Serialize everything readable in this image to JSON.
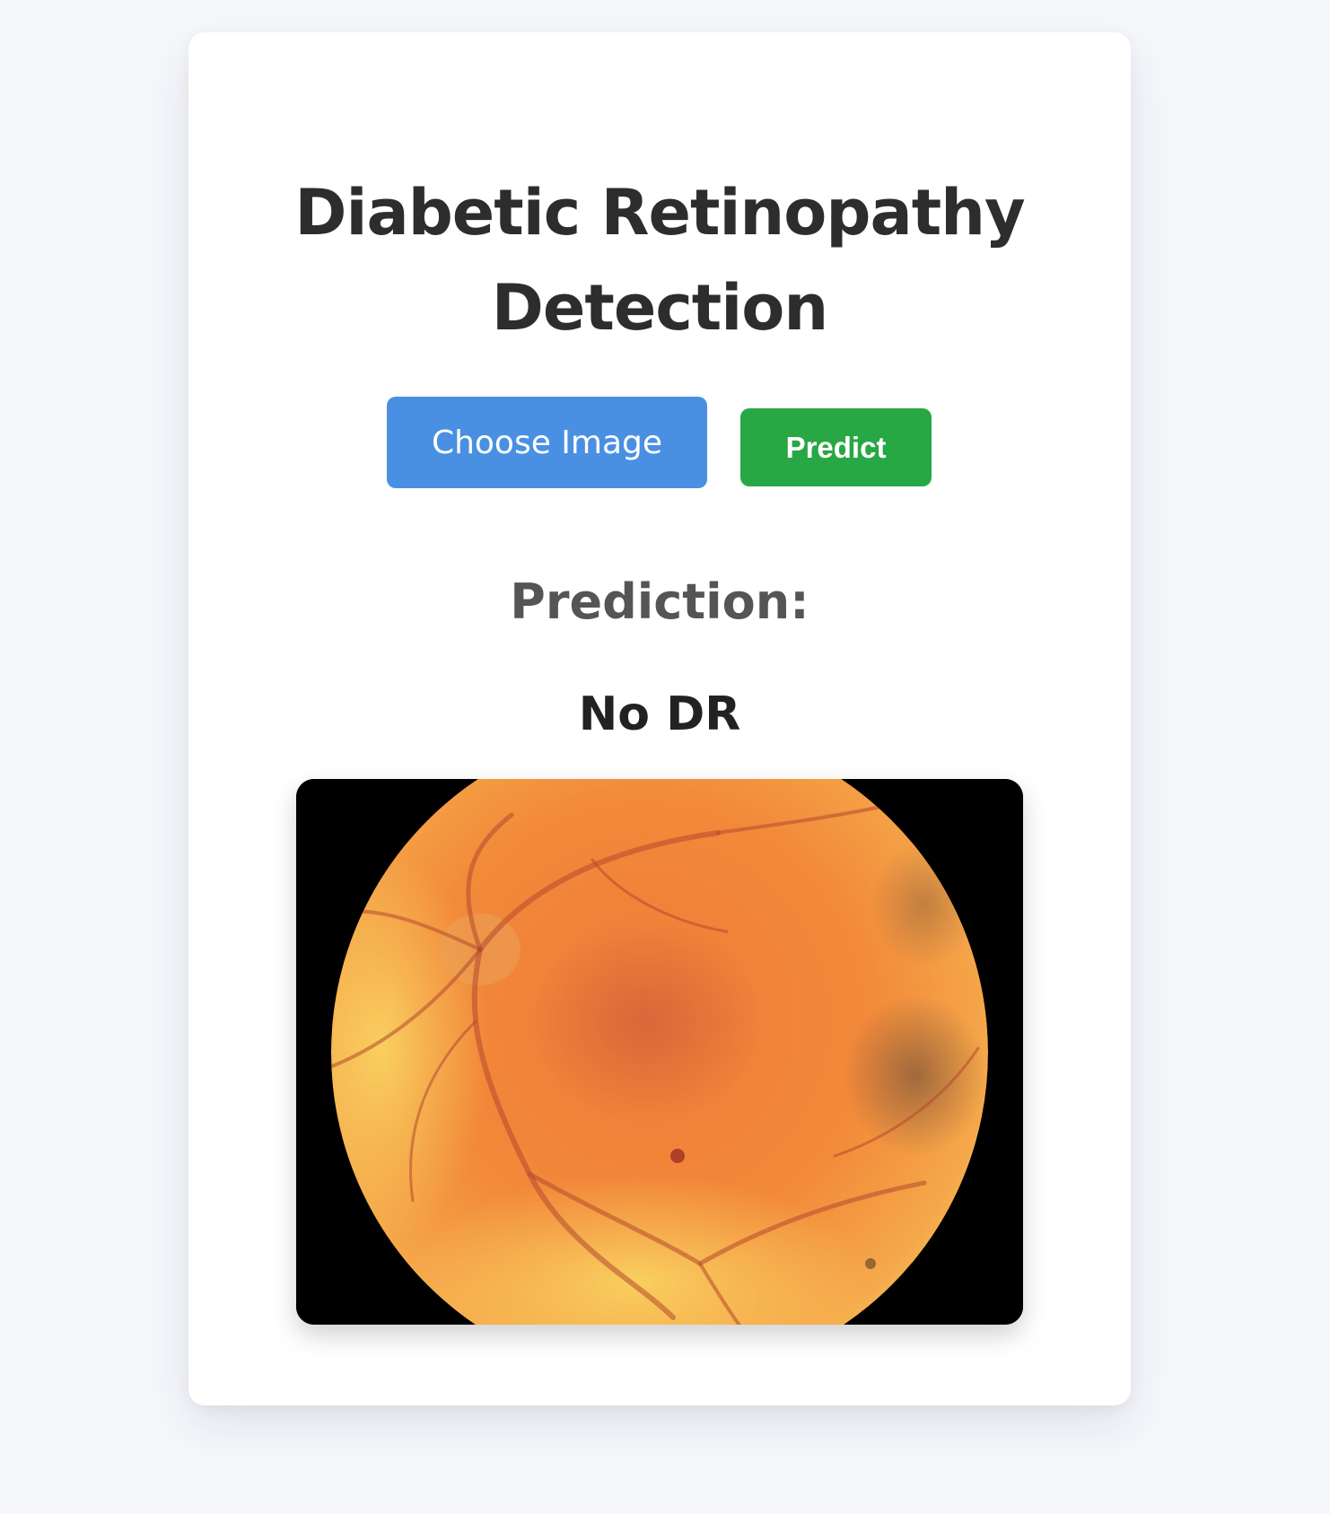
{
  "header": {
    "title_line1": "Diabetic Retinopathy",
    "title_line2": "Detection"
  },
  "actions": {
    "choose_label": "Choose Image",
    "predict_label": "Predict"
  },
  "result": {
    "label": "Prediction:",
    "value": "No DR"
  },
  "colors": {
    "page_background": "#f6f7fb",
    "choose_button": "#4a90e2",
    "predict_button": "#28a745",
    "title_text": "#2d2d2d"
  }
}
